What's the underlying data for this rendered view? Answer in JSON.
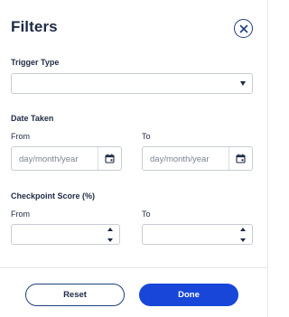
{
  "header": {
    "title": "Filters"
  },
  "trigger_type": {
    "label": "Trigger Type",
    "selected": ""
  },
  "date_taken": {
    "label": "Date Taken",
    "from_label": "From",
    "to_label": "To",
    "from_placeholder": "day/month/year",
    "to_placeholder": "day/month/year"
  },
  "checkpoint_score": {
    "label": "Checkpoint Score (%)",
    "from_label": "From",
    "to_label": "To",
    "from_value": "",
    "to_value": ""
  },
  "footer": {
    "reset_label": "Reset",
    "done_label": "Done"
  },
  "colors": {
    "primary": "#1746d9",
    "text": "#1e2a44",
    "outline": "#1f3f7a",
    "border": "#c8ccd4"
  }
}
